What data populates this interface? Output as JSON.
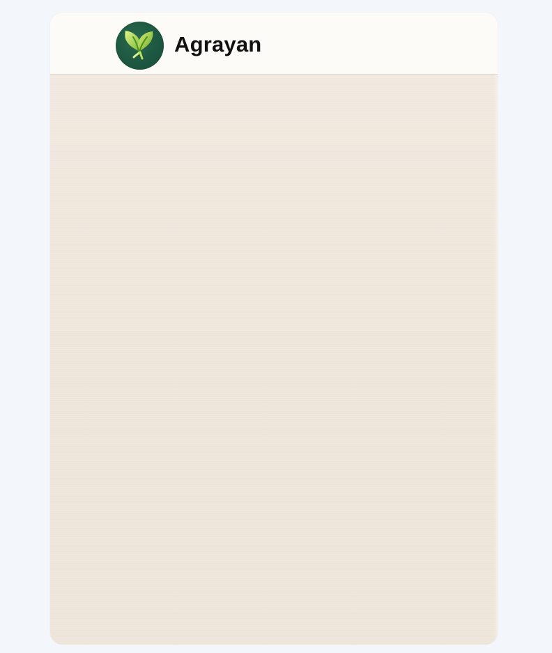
{
  "header": {
    "brand_name": "Agrayan",
    "logo_icon": "leaf-logo-icon"
  },
  "colors": {
    "page_background": "#f3f7fb",
    "header_background": "#fcfbf8",
    "content_background": "#efe6da",
    "logo_background": "#1f5b43",
    "logo_leaf_primary": "#8fc63f",
    "logo_leaf_secondary": "#b7df5a",
    "brand_text": "#111111"
  }
}
